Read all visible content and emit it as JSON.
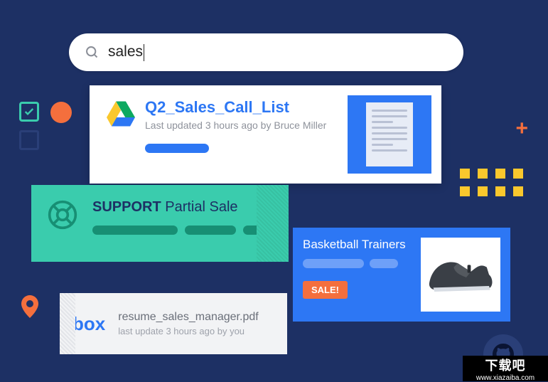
{
  "search": {
    "query": "sales"
  },
  "cards": {
    "drive": {
      "title": "Q2_Sales_Call_List",
      "subtitle": "Last updated 3 hours ago by Bruce Miller"
    },
    "support": {
      "title_bold": "SUPPORT",
      "title_rest": " Partial Sale"
    },
    "product": {
      "title": "Basketball Trainers",
      "badge": "SALE!"
    },
    "box": {
      "logo": "box",
      "title": "resume_sales_manager.pdf",
      "subtitle": "last update 3 hours ago by you"
    }
  },
  "watermark": {
    "text": "下载吧",
    "url": "www.xiazaiba.com"
  }
}
